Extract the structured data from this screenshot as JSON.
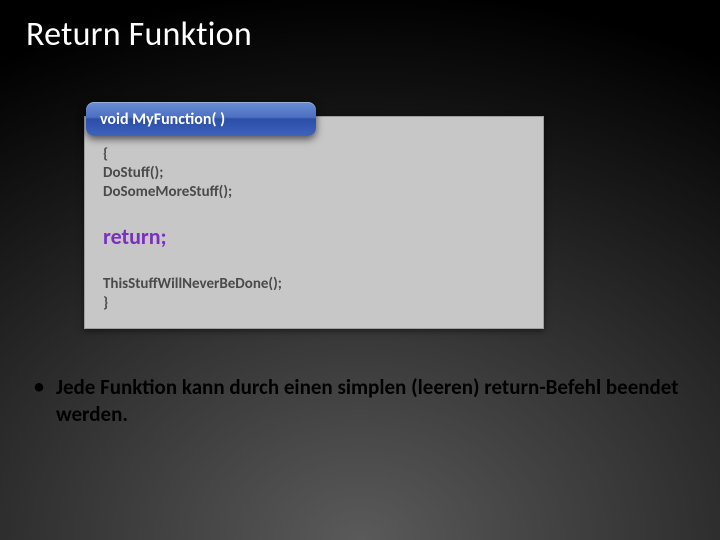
{
  "title": "Return Funktion",
  "code": {
    "header": "void MyFunction( )",
    "line_open": "{",
    "line1": "DoStuff();",
    "line2": "DoSomeMoreStuff();",
    "return_line": "return;",
    "line3": "ThisStuffWillNeverBeDone();",
    "line_close": "}"
  },
  "bullet": {
    "marker": "•",
    "text": "Jede Funktion kann durch einen simplen (leeren) return-Befehl beendet werden."
  }
}
